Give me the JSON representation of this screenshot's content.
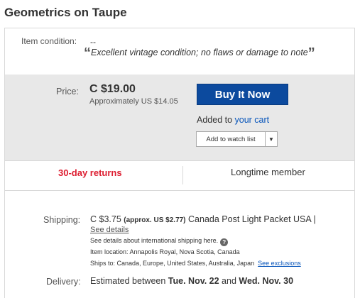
{
  "item": {
    "title": "Geometrics on Taupe"
  },
  "condition": {
    "label": "Item condition:",
    "value": "--",
    "quote_open": "“",
    "quote": "Excellent vintage condition; no flaws or damage to note",
    "quote_close": "”"
  },
  "price": {
    "label": "Price:",
    "value": "C $19.00",
    "approx": "Approximately US $14.05"
  },
  "actions": {
    "buy_now": "Buy It Now",
    "added_prefix": "Added to ",
    "added_link": "your cart",
    "watch_list": "Add to watch list"
  },
  "badges": {
    "returns": "30-day returns",
    "member": "Longtime member"
  },
  "shipping": {
    "label": "Shipping:",
    "cost": "C $3.75",
    "approx": "(approx. US $2.77)",
    "service": "Canada Post Light Packet USA |",
    "see_details": "See details",
    "intl_note": "See details about international shipping here.",
    "location": "Item location:  Annapolis Royal, Nova Scotia, Canada",
    "ships_to": "Ships to:  Canada, Europe, United States, Australia, Japan",
    "see_exclusions": "See exclusions"
  },
  "delivery": {
    "label": "Delivery:",
    "prefix": "Estimated between ",
    "date_start": "Tue. Nov. 22",
    "middle": " and ",
    "date_end": "Wed. Nov. 30"
  },
  "colors": {
    "buy_button": "#0c4a9e",
    "returns_red": "#dd1e31",
    "link_blue": "#0654ba",
    "panel_gray": "#e8e8e8"
  }
}
